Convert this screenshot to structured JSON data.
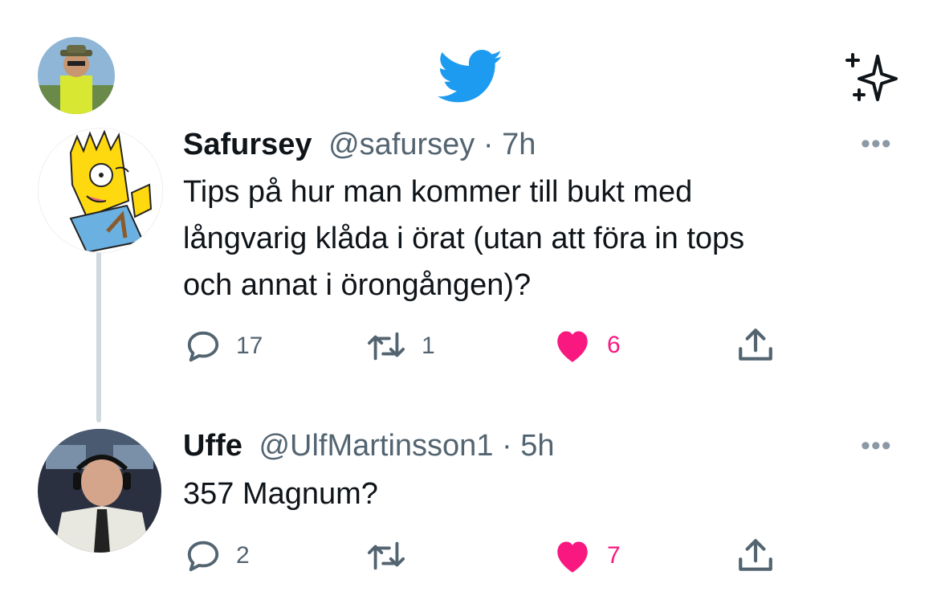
{
  "header": {
    "logo_icon": "twitter-bird-icon",
    "sparkle_icon": "sparkle-icon",
    "brand_color": "#1d9bf0"
  },
  "tweets": [
    {
      "display_name": "Safursey",
      "handle": "@safursey",
      "separator": "·",
      "time": "7h",
      "lines": [
        "Tips på hur man kommer till bukt med",
        "långvarig klåda i örat (utan att föra in tops",
        "och annat i örongången)?"
      ],
      "more": "•••",
      "replies": "17",
      "retweets": "1",
      "likes": "6",
      "liked": true
    },
    {
      "display_name": "Uffe",
      "handle": "@UlfMartinsson1",
      "separator": "·",
      "time": "5h",
      "lines": [
        "357 Magnum?"
      ],
      "more": "•••",
      "replies": "2",
      "retweets": "",
      "likes": "7",
      "liked": true
    }
  ],
  "colors": {
    "like": "#f91880",
    "icon": "#536471",
    "thread": "#cfd9de"
  }
}
